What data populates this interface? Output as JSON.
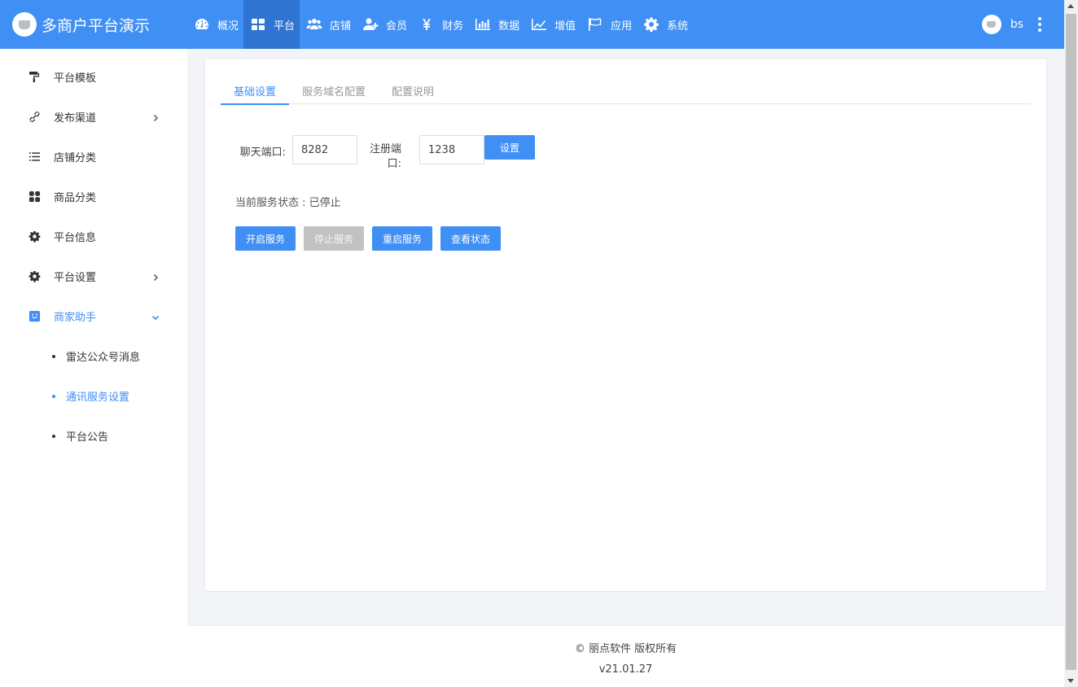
{
  "header": {
    "brand_title": "多商户平台演示",
    "nav": [
      {
        "label": "概况",
        "icon": "dashboard-icon"
      },
      {
        "label": "平台",
        "icon": "grid-icon",
        "active": true
      },
      {
        "label": "店铺",
        "icon": "users-icon"
      },
      {
        "label": "会员",
        "icon": "user-plus-icon"
      },
      {
        "label": "财务",
        "icon": "yen-icon"
      },
      {
        "label": "数据",
        "icon": "bar-chart-icon"
      },
      {
        "label": "增值",
        "icon": "line-chart-icon"
      },
      {
        "label": "应用",
        "icon": "flag-icon"
      },
      {
        "label": "系统",
        "icon": "gear-icon"
      }
    ],
    "user_name": "bs"
  },
  "sidebar": {
    "items": [
      {
        "label": "平台模板",
        "icon": "paint-roller-icon"
      },
      {
        "label": "发布渠道",
        "icon": "link-icon",
        "expandable": true
      },
      {
        "label": "店铺分类",
        "icon": "list-icon"
      },
      {
        "label": "商品分类",
        "icon": "apps-icon"
      },
      {
        "label": "平台信息",
        "icon": "gear-icon"
      },
      {
        "label": "平台设置",
        "icon": "gear-icon",
        "expandable": true
      },
      {
        "label": "商家助手",
        "icon": "smile-icon",
        "expanded": true
      }
    ],
    "subitems": [
      {
        "label": "雷达公众号消息"
      },
      {
        "label": "通讯服务设置",
        "active": true
      },
      {
        "label": "平台公告"
      }
    ]
  },
  "main": {
    "tabs": [
      {
        "label": "基础设置",
        "active": true
      },
      {
        "label": "服务域名配置"
      },
      {
        "label": "配置说明"
      }
    ],
    "chat_port_label": "聊天端口:",
    "chat_port_value": "8282",
    "register_port_label": "注册端口:",
    "register_port_value": "1238",
    "set_button": "设置",
    "status_text": "当前服务状态 : 已停止",
    "buttons": {
      "start": "开启服务",
      "stop": "停止服务",
      "restart": "重启服务",
      "check": "查看状态"
    }
  },
  "footer": {
    "copyright": "© 丽点软件 版权所有",
    "version": "v21.01.27"
  },
  "colors": {
    "primary": "#3f8ff5",
    "primary_dark": "#2f74d0",
    "disabled": "#c2c2c2"
  }
}
